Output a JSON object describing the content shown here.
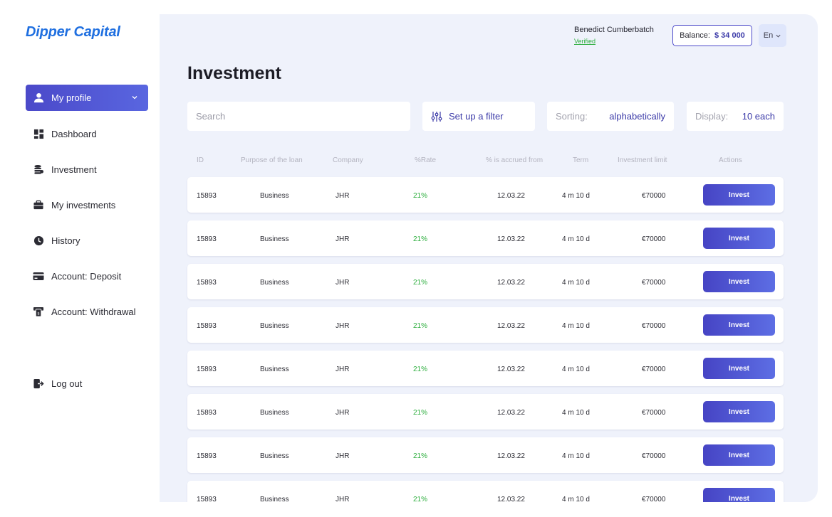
{
  "app": {
    "logo": "Dipper Capital"
  },
  "sidebar": {
    "items": [
      {
        "label": "My profile",
        "icon": "user-icon"
      },
      {
        "label": "Dashboard",
        "icon": "dashboard-icon"
      },
      {
        "label": "Investment",
        "icon": "coins-icon"
      },
      {
        "label": "My investments",
        "icon": "briefcase-icon"
      },
      {
        "label": "History",
        "icon": "history-icon"
      },
      {
        "label": "Account: Deposit",
        "icon": "card-icon"
      },
      {
        "label": "Account: Withdrawal",
        "icon": "withdrawal-icon"
      }
    ],
    "logout": {
      "label": "Log out",
      "icon": "logout-icon"
    }
  },
  "header": {
    "user_name": "Benedict Cumberbatch",
    "user_status": "Verified",
    "balance_label": "Balance:",
    "balance_value": "$ 34 000",
    "language": "En"
  },
  "main": {
    "title": "Investment",
    "search_placeholder": "Search",
    "filter_label": "Set up a filter",
    "sorting_label": "Sorting:",
    "sorting_value": "alphabetically",
    "display_label": "Display:",
    "display_value": "10 each"
  },
  "table": {
    "columns": [
      "ID",
      "Purpose of the loan",
      "Company",
      "%Rate",
      "% is accrued from",
      "Term",
      "Investment limit",
      "Actions"
    ],
    "action_label": "Invest",
    "rows": [
      {
        "id": "15893",
        "purpose": "Business",
        "company": "JHR",
        "rate": "21%",
        "accrued": "12.03.22",
        "term": "4 m 10 d",
        "limit": "€70000"
      },
      {
        "id": "15893",
        "purpose": "Business",
        "company": "JHR",
        "rate": "21%",
        "accrued": "12.03.22",
        "term": "4 m 10 d",
        "limit": "€70000"
      },
      {
        "id": "15893",
        "purpose": "Business",
        "company": "JHR",
        "rate": "21%",
        "accrued": "12.03.22",
        "term": "4 m 10 d",
        "limit": "€70000"
      },
      {
        "id": "15893",
        "purpose": "Business",
        "company": "JHR",
        "rate": "21%",
        "accrued": "12.03.22",
        "term": "4 m 10 d",
        "limit": "€70000"
      },
      {
        "id": "15893",
        "purpose": "Business",
        "company": "JHR",
        "rate": "21%",
        "accrued": "12.03.22",
        "term": "4 m 10 d",
        "limit": "€70000"
      },
      {
        "id": "15893",
        "purpose": "Business",
        "company": "JHR",
        "rate": "21%",
        "accrued": "12.03.22",
        "term": "4 m 10 d",
        "limit": "€70000"
      },
      {
        "id": "15893",
        "purpose": "Business",
        "company": "JHR",
        "rate": "21%",
        "accrued": "12.03.22",
        "term": "4 m 10 d",
        "limit": "€70000"
      },
      {
        "id": "15893",
        "purpose": "Business",
        "company": "JHR",
        "rate": "21%",
        "accrued": "12.03.22",
        "term": "4 m 10 d",
        "limit": "€70000"
      }
    ]
  }
}
